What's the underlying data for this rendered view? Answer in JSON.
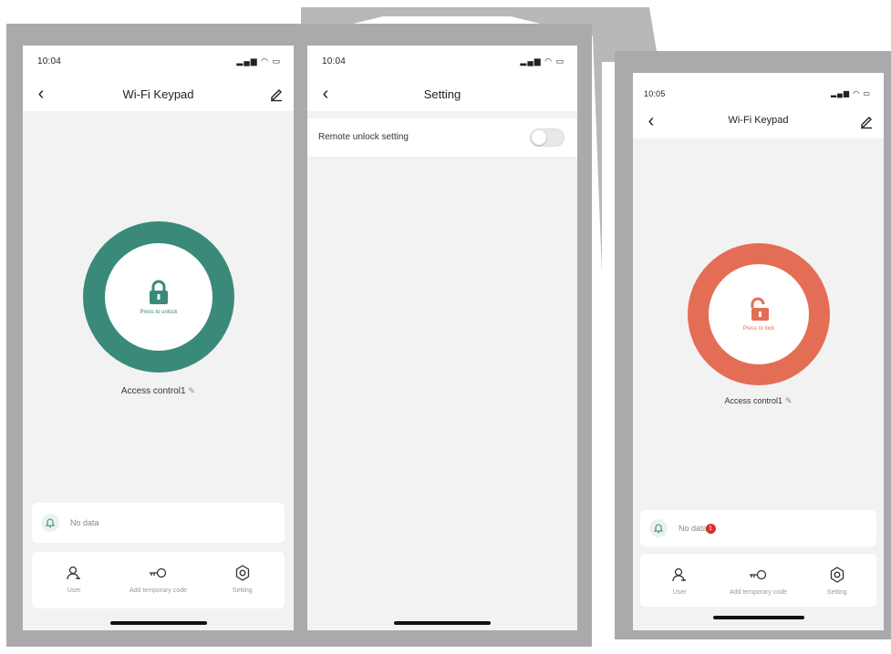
{
  "colors": {
    "unlock_ring": "#3a8a7a",
    "lock_ring": "#e46e55",
    "frame": "#a9aaab",
    "background_shape": "#b7b8b9"
  },
  "screens": [
    {
      "status": {
        "time": "10:04",
        "icons": "signal-wifi-battery"
      },
      "nav": {
        "title": "Wi-Fi Keypad"
      },
      "button": {
        "label": "Press to unlock",
        "icon": "lock-closed-icon"
      },
      "device_name": "Access control1",
      "notification": {
        "text": "No data"
      },
      "actions": [
        {
          "label": "User",
          "icon": "user-icon"
        },
        {
          "label": "Add temporary code",
          "icon": "key-icon"
        },
        {
          "label": "Setting",
          "icon": "gear-icon"
        }
      ]
    },
    {
      "status": {
        "time": "10:04"
      },
      "nav": {
        "title": "Setting"
      },
      "setting": {
        "label": "Remote unlock setting",
        "toggle_on": false
      }
    },
    {
      "status": {
        "time": "10:05"
      },
      "nav": {
        "title": "Wi-Fi Keypad"
      },
      "button": {
        "label": "Press to lock",
        "icon": "lock-open-icon"
      },
      "device_name": "Access control1",
      "notification": {
        "text": "No data",
        "badge": "1"
      },
      "actions": [
        {
          "label": "User",
          "icon": "user-icon"
        },
        {
          "label": "Add temporary code",
          "icon": "key-icon"
        },
        {
          "label": "Setting",
          "icon": "gear-icon"
        }
      ]
    }
  ]
}
